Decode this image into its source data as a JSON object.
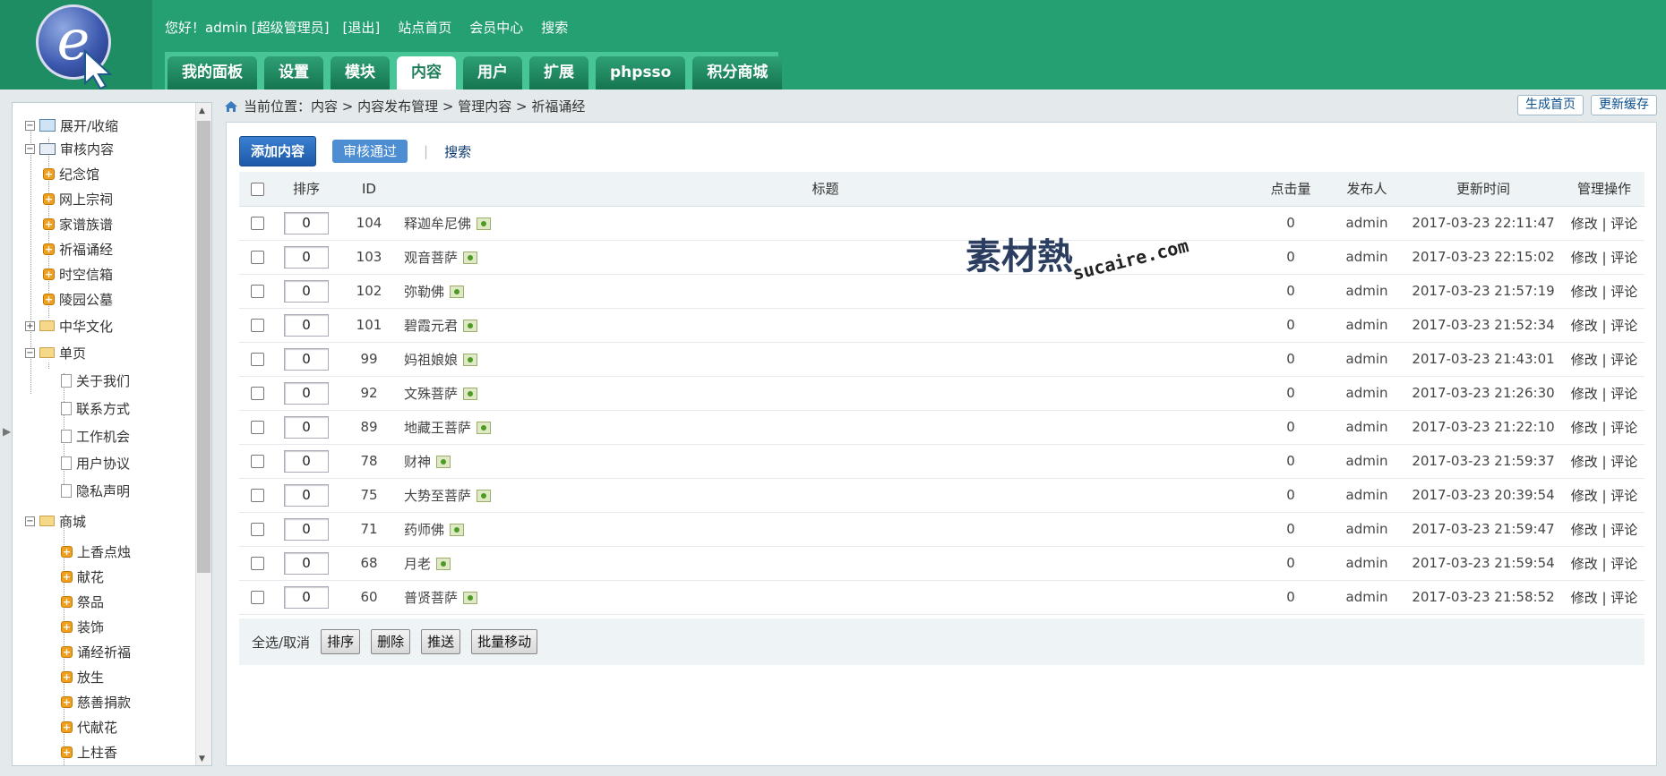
{
  "topnav": {
    "greeting": "您好！admin [超级管理员]",
    "logout": "[退出]",
    "site_home": "站点首页",
    "member_center": "会员中心",
    "search": "搜索"
  },
  "tabs": [
    "我的面板",
    "设置",
    "模块",
    "内容",
    "用户",
    "扩展",
    "phpsso",
    "积分商城"
  ],
  "active_tab": "内容",
  "sidebar": {
    "expand": "展开/收缩",
    "review": "审核内容",
    "group1": [
      "纪念馆",
      "网上宗祠",
      "家谱族谱",
      "祈福诵经",
      "时空信箱",
      "陵园公墓"
    ],
    "culture": "中华文化",
    "single_page": "单页",
    "pages": [
      "关于我们",
      "联系方式",
      "工作机会",
      "用户协议",
      "隐私声明"
    ],
    "mall": "商城",
    "mall_items": [
      "上香点烛",
      "献花",
      "祭品",
      "装饰",
      "诵经祈福",
      "放生",
      "慈善捐款",
      "代献花",
      "上柱香"
    ]
  },
  "breadcrumb": "当前位置：内容 > 内容发布管理 > 管理内容 > 祈福诵经",
  "top_buttons": {
    "gen_home": "生成首页",
    "update_cache": "更新缓存"
  },
  "toolbar": {
    "add": "添加内容",
    "approve": "审核通过",
    "search": "搜索"
  },
  "table": {
    "headers": {
      "order": "排序",
      "id": "ID",
      "title": "标题",
      "hits": "点击量",
      "author": "发布人",
      "updated": "更新时间",
      "ops": "管理操作"
    },
    "rows": [
      {
        "order": "0",
        "id": "104",
        "title": "释迦牟尼佛",
        "hits": "0",
        "author": "admin",
        "time": "2017-03-23 22:11:47",
        "ops": "修改 | 评论"
      },
      {
        "order": "0",
        "id": "103",
        "title": "观音菩萨",
        "hits": "0",
        "author": "admin",
        "time": "2017-03-23 22:15:02",
        "ops": "修改 | 评论"
      },
      {
        "order": "0",
        "id": "102",
        "title": "弥勒佛",
        "hits": "0",
        "author": "admin",
        "time": "2017-03-23 21:57:19",
        "ops": "修改 | 评论"
      },
      {
        "order": "0",
        "id": "101",
        "title": "碧霞元君",
        "hits": "0",
        "author": "admin",
        "time": "2017-03-23 21:52:34",
        "ops": "修改 | 评论"
      },
      {
        "order": "0",
        "id": "99",
        "title": "妈祖娘娘",
        "hits": "0",
        "author": "admin",
        "time": "2017-03-23 21:43:01",
        "ops": "修改 | 评论"
      },
      {
        "order": "0",
        "id": "92",
        "title": "文殊菩萨",
        "hits": "0",
        "author": "admin",
        "time": "2017-03-23 21:26:30",
        "ops": "修改 | 评论"
      },
      {
        "order": "0",
        "id": "89",
        "title": "地藏王菩萨",
        "hits": "0",
        "author": "admin",
        "time": "2017-03-23 21:22:10",
        "ops": "修改 | 评论"
      },
      {
        "order": "0",
        "id": "78",
        "title": "财神",
        "hits": "0",
        "author": "admin",
        "time": "2017-03-23 21:59:37",
        "ops": "修改 | 评论"
      },
      {
        "order": "0",
        "id": "75",
        "title": "大势至菩萨",
        "hits": "0",
        "author": "admin",
        "time": "2017-03-23 20:39:54",
        "ops": "修改 | 评论"
      },
      {
        "order": "0",
        "id": "71",
        "title": "药师佛",
        "hits": "0",
        "author": "admin",
        "time": "2017-03-23 21:59:47",
        "ops": "修改 | 评论"
      },
      {
        "order": "0",
        "id": "68",
        "title": "月老",
        "hits": "0",
        "author": "admin",
        "time": "2017-03-23 21:59:54",
        "ops": "修改 | 评论"
      },
      {
        "order": "0",
        "id": "60",
        "title": "普贤菩萨",
        "hits": "0",
        "author": "admin",
        "time": "2017-03-23 21:58:52",
        "ops": "修改 | 评论"
      }
    ]
  },
  "footer": {
    "select_all": "全选/取消",
    "sort": "排序",
    "delete": "删除",
    "push": "推送",
    "batch_move": "批量移动"
  },
  "watermark": {
    "cn": "素材熱",
    "en": "sucaire.com"
  },
  "colors": {
    "header": "#24a072",
    "tab_strip": "#48c596",
    "accent_blue": "#1d5aa8"
  }
}
